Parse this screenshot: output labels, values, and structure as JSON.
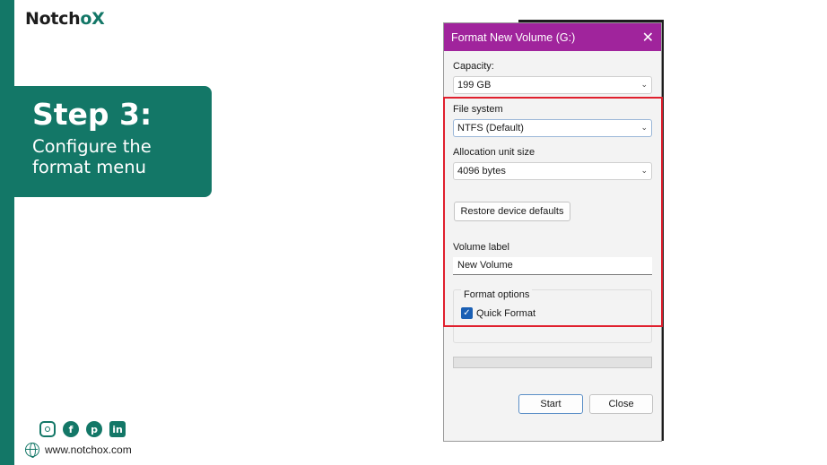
{
  "brand": {
    "logo_part1": "Notch",
    "logo_accent": "o",
    "logo_part2": "X",
    "website": "www.notchox.com"
  },
  "step": {
    "title": "Step 3:",
    "line1": "Configure the",
    "line2": "format menu"
  },
  "social_icons": [
    "instagram-icon",
    "facebook-icon",
    "pinterest-icon",
    "linkedin-icon"
  ],
  "dialog": {
    "title": "Format New Volume (G:)",
    "capacity_label": "Capacity:",
    "capacity_value": "199 GB",
    "filesystem_label": "File system",
    "filesystem_value": "NTFS (Default)",
    "alloc_label": "Allocation unit size",
    "alloc_value": "4096 bytes",
    "restore_label": "Restore device defaults",
    "volume_label_label": "Volume label",
    "volume_label_value": "New Volume",
    "format_options_label": "Format options",
    "quick_format_label": "Quick Format",
    "quick_format_checked": true,
    "progress": 0,
    "start_label": "Start",
    "close_label": "Close"
  },
  "colors": {
    "brand_teal": "#137767",
    "titlebar": "#a0249c",
    "highlight": "#e0202e",
    "checkbox": "#1a5fb4"
  }
}
